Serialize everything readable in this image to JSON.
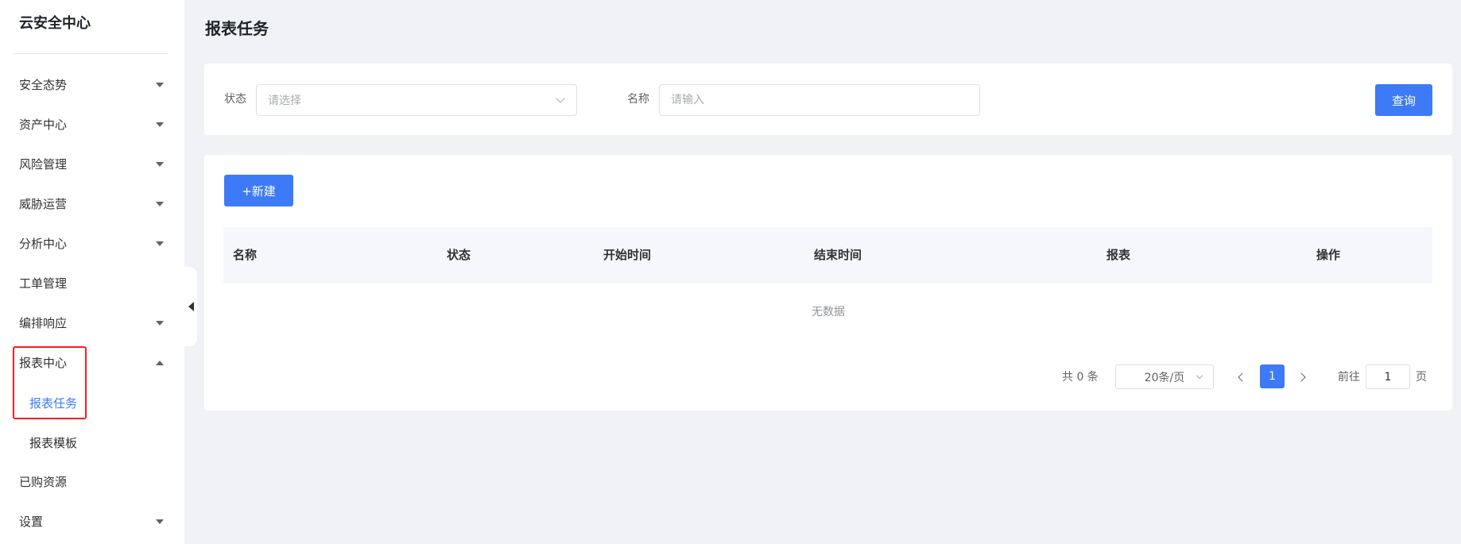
{
  "sidebar": {
    "brand": "云安全中心",
    "items": [
      {
        "label": "安全态势",
        "expandable": true
      },
      {
        "label": "资产中心",
        "expandable": true
      },
      {
        "label": "风险管理",
        "expandable": true
      },
      {
        "label": "威胁运营",
        "expandable": true
      },
      {
        "label": "分析中心",
        "expandable": true
      },
      {
        "label": "工单管理",
        "expandable": false
      },
      {
        "label": "编排响应",
        "expandable": true
      },
      {
        "label": "报表中心",
        "expandable": true,
        "expanded": true
      },
      {
        "label": "已购资源",
        "expandable": false
      },
      {
        "label": "设置",
        "expandable": true
      }
    ],
    "report_children": [
      {
        "label": "报表任务",
        "active": true
      },
      {
        "label": "报表模板",
        "active": false
      }
    ]
  },
  "page": {
    "title": "报表任务"
  },
  "filter": {
    "status_label": "状态",
    "status_placeholder": "请选择",
    "name_label": "名称",
    "name_placeholder": "请输入",
    "search_button": "查询"
  },
  "table": {
    "new_button": "+新建",
    "columns": [
      "名称",
      "状态",
      "开始时间",
      "结束时间",
      "报表",
      "操作"
    ],
    "rows": [],
    "empty_text": "无数据"
  },
  "pagination": {
    "total_text": "共 0 条",
    "page_size": "20条/页",
    "current_page": "1",
    "goto_label": "前往",
    "goto_value": "1",
    "page_suffix": "页"
  },
  "colors": {
    "primary": "#3d7af5",
    "highlight": "#f0202a"
  }
}
